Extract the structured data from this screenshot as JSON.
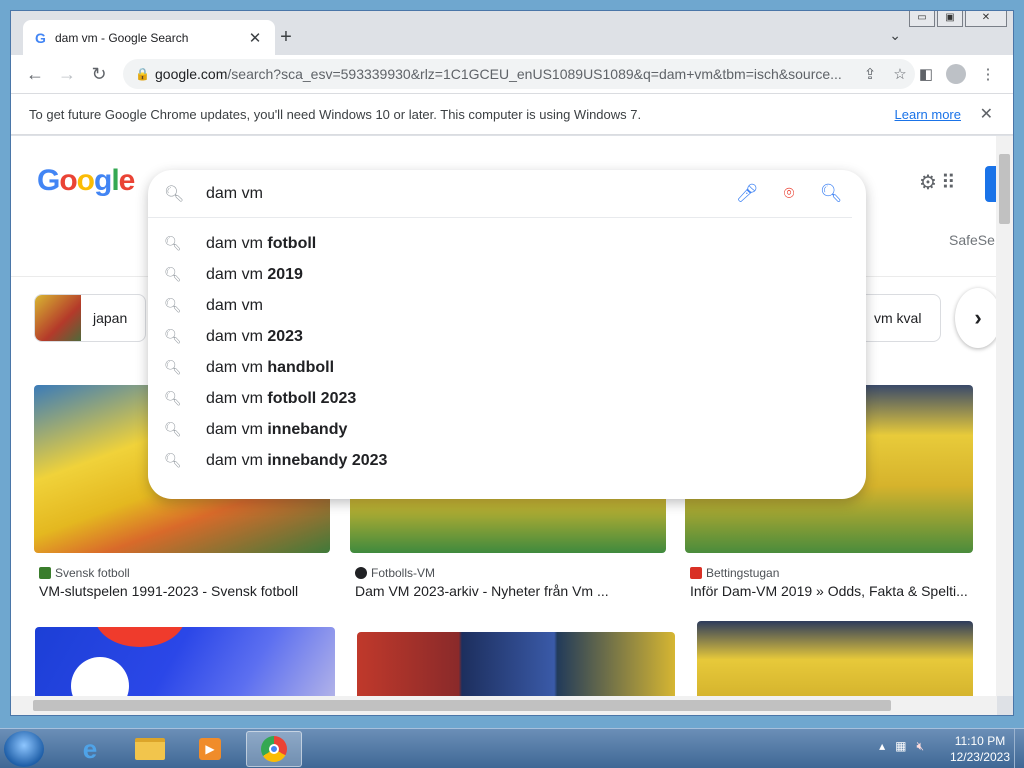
{
  "tab": {
    "title": "dam vm - Google Search",
    "favicon": "G"
  },
  "toolbar": {
    "url_host": "google.com",
    "url_rest": "/search?sca_esv=593339930&rlz=1C1GCEU_enUS1089US1089&q=dam+vm&tbm=isch&source..."
  },
  "infobar": {
    "message": "To get future Google Chrome updates, you'll need Windows 10 or later. This computer is using Windows 7.",
    "learn_more": "Learn more"
  },
  "search": {
    "query": "dam vm",
    "suggestions": [
      {
        "prefix": "dam vm",
        "bold": "fotboll"
      },
      {
        "prefix": "dam vm",
        "bold": "2019"
      },
      {
        "prefix": "dam vm",
        "bold": ""
      },
      {
        "prefix": "dam vm",
        "bold": "2023"
      },
      {
        "prefix": "dam vm",
        "bold": "handboll"
      },
      {
        "prefix": "dam vm",
        "bold": "fotboll 2023"
      },
      {
        "prefix": "dam vm",
        "bold": "innebandy"
      },
      {
        "prefix": "dam vm",
        "bold": "innebandy 2023"
      }
    ]
  },
  "header": {
    "safesearch_partial": "SafeSe"
  },
  "chips": [
    {
      "label": "japan"
    },
    {
      "label": "vm kval"
    }
  ],
  "results": [
    {
      "source": "Svensk fotboll",
      "caption": "VM-slutspelen 1991-2023 - Svensk fotboll",
      "source_color": "#3a7d2c"
    },
    {
      "source": "Fotbolls-VM",
      "caption": "Dam VM 2023-arkiv - Nyheter från Vm ...",
      "source_color": "#202124"
    },
    {
      "source": "Bettingstugan",
      "caption": "Inför Dam-VM 2019 » Odds, Fakta & Spelti...",
      "source_color": "#d93025"
    }
  ],
  "taskbar": {
    "time": "11:10 PM",
    "date": "12/23/2023"
  }
}
